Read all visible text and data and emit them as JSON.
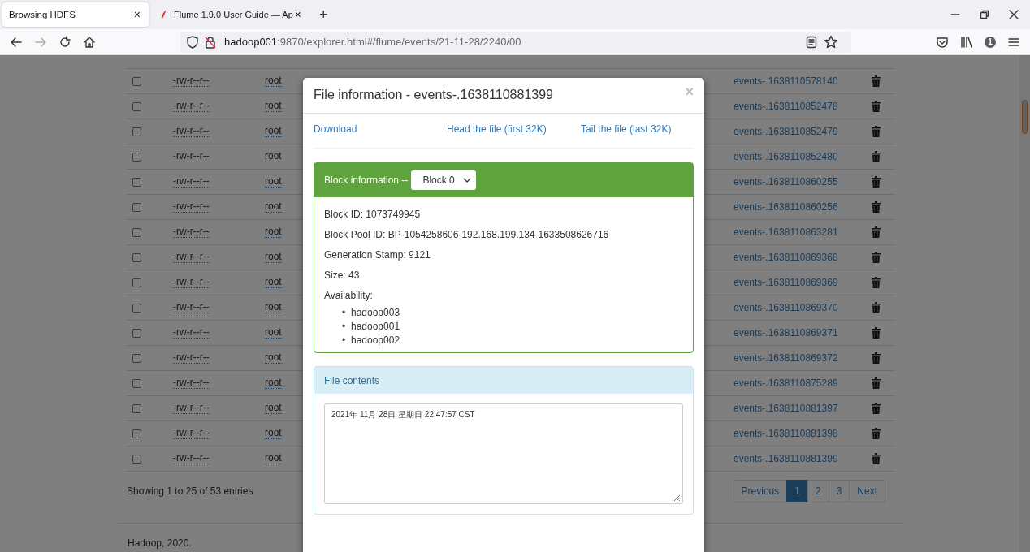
{
  "browser": {
    "tabs": [
      {
        "title": "Browsing HDFS",
        "selected": true,
        "close": "×"
      },
      {
        "title": "Flume 1.9.0 User Guide — Ap",
        "selected": false,
        "close": "×"
      }
    ],
    "new_tab": "+",
    "address": {
      "host": "hadoop001",
      "path": ":9870/explorer.html#/flume/events/21-11-28/2240/00"
    },
    "account_badge": "1"
  },
  "files": {
    "rows": [
      {
        "checked": false,
        "permission": "-rw-r--r--",
        "owner": "root",
        "name": "events-.1638110578140"
      },
      {
        "checked": false,
        "permission": "-rw-r--r--",
        "owner": "root",
        "name": "events-.1638110852478"
      },
      {
        "checked": false,
        "permission": "-rw-r--r--",
        "owner": "root",
        "name": "events-.1638110852479"
      },
      {
        "checked": false,
        "permission": "-rw-r--r--",
        "owner": "root",
        "name": "events-.1638110852480"
      },
      {
        "checked": false,
        "permission": "-rw-r--r--",
        "owner": "root",
        "name": "events-.1638110860255"
      },
      {
        "checked": false,
        "permission": "-rw-r--r--",
        "owner": "root",
        "name": "events-.1638110860256"
      },
      {
        "checked": false,
        "permission": "-rw-r--r--",
        "owner": "root",
        "name": "events-.1638110863281"
      },
      {
        "checked": false,
        "permission": "-rw-r--r--",
        "owner": "root",
        "name": "events-.1638110869368"
      },
      {
        "checked": false,
        "permission": "-rw-r--r--",
        "owner": "root",
        "name": "events-.1638110869369"
      },
      {
        "checked": false,
        "permission": "-rw-r--r--",
        "owner": "root",
        "name": "events-.1638110869370"
      },
      {
        "checked": false,
        "permission": "-rw-r--r--",
        "owner": "root",
        "name": "events-.1638110869371"
      },
      {
        "checked": false,
        "permission": "-rw-r--r--",
        "owner": "root",
        "name": "events-.1638110869372"
      },
      {
        "checked": false,
        "permission": "-rw-r--r--",
        "owner": "root",
        "name": "events-.1638110875289"
      },
      {
        "checked": false,
        "permission": "-rw-r--r--",
        "owner": "root",
        "name": "events-.1638110881397"
      },
      {
        "checked": false,
        "permission": "-rw-r--r--",
        "owner": "root",
        "name": "events-.1638110881398"
      },
      {
        "checked": false,
        "permission": "-rw-r--r--",
        "owner": "root",
        "name": "events-.1638110881399"
      }
    ],
    "summary": "Showing 1 to 25 of 53 entries",
    "pagination": [
      {
        "label": "Previous",
        "selected": false
      },
      {
        "label": "1",
        "selected": true
      },
      {
        "label": "2",
        "selected": false
      },
      {
        "label": "3",
        "selected": false
      },
      {
        "label": "Next",
        "selected": false
      }
    ]
  },
  "footer": "Hadoop, 2020.",
  "modal": {
    "title": "File information - events-.1638110881399",
    "close": "×",
    "links": [
      "Download",
      "Head the file (first 32K)",
      "Tail the file (last 32K)"
    ],
    "block_panel": {
      "title": "Block information --",
      "select": "Block 0",
      "fields": [
        "Block ID: 1073749945",
        "Block Pool ID: BP-1054258606-192.168.199.134-1633508626716",
        "Generation Stamp: 9121",
        "Size: 43"
      ],
      "availability_label": "Availability:",
      "hosts": [
        {
          "marker": "•",
          "name": "hadoop003"
        },
        {
          "marker": "•",
          "name": "hadoop001"
        },
        {
          "marker": "•",
          "name": "hadoop002"
        }
      ]
    },
    "contents_panel": {
      "title": "File contents",
      "text": "2021年 11月 28日 星期日 22:47:57 CST"
    }
  }
}
